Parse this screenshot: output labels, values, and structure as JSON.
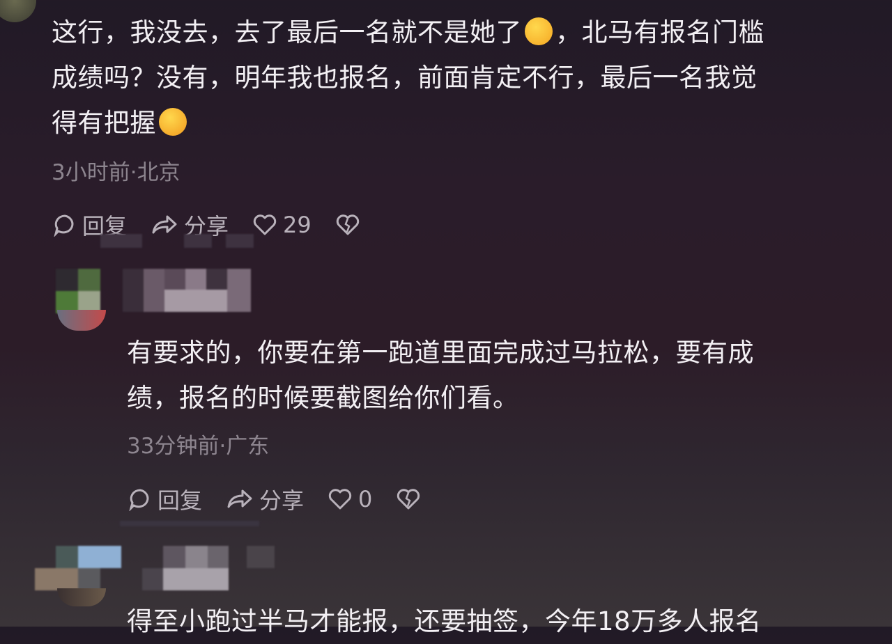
{
  "comments": [
    {
      "text_line1": "这行，我没去，去了最后一名就不是她了",
      "text_line1_tail": "，北马有报名门槛",
      "text_line2": "成绩吗？没有，明年我也报名，前面肯定不行，最后一名我觉",
      "text_line3": "得有把握",
      "meta": "3小时前·北京",
      "reply_label": "回复",
      "share_label": "分享",
      "likes": "29"
    },
    {
      "text_line1": "有要求的，你要在第一跑道里面完成过马拉松，要有成",
      "text_line2": "绩，报名的时候要截图给你们看。",
      "meta": "33分钟前·广东",
      "reply_label": "回复",
      "share_label": "分享",
      "likes": "0"
    },
    {
      "text_line1": "得至小跑过半马才能报，还要抽签，今年18万多人报名"
    }
  ],
  "icons": {
    "reply": "comment-bubble-icon",
    "share": "share-arrow-icon",
    "like": "heart-icon",
    "dislike": "broken-heart-icon",
    "emoji1": "rolling-laughing-emoji",
    "emoji2": "heart-eyes-emoji"
  }
}
